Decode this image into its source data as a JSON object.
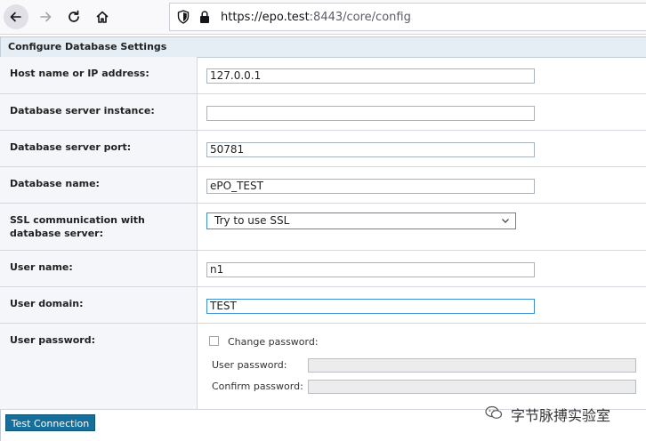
{
  "browser": {
    "url_host": "https://epo.test",
    "url_rest": ":8443/core/config"
  },
  "panel": {
    "title": "Configure Database Settings"
  },
  "form": {
    "host_label": "Host name or IP address:",
    "host_value": "127.0.0.1",
    "instance_label": "Database server instance:",
    "instance_value": "",
    "port_label": "Database server port:",
    "port_value": "50781",
    "dbname_label": "Database name:",
    "dbname_value": "ePO_TEST",
    "ssl_label": "SSL communication with database server:",
    "ssl_value": "Try to use SSL",
    "user_label": "User name:",
    "user_value": "n1",
    "domain_label": "User domain:",
    "domain_value": "TEST",
    "password_label": "User password:",
    "change_password_label": "Change password:",
    "change_password_checked": false,
    "user_password_label": "User password:",
    "confirm_password_label": "Confirm password:"
  },
  "actions": {
    "test_connection": "Test Connection"
  },
  "watermark": {
    "text": "字节脉搏实验室"
  }
}
